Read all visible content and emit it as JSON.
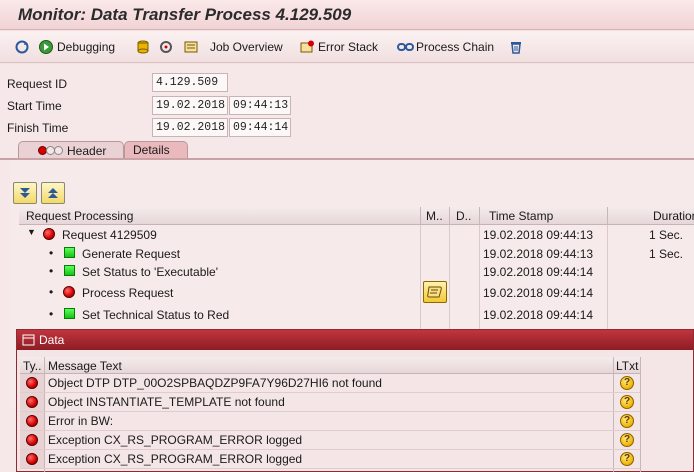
{
  "window": {
    "title": "Monitor: Data Transfer Process 4.129.509"
  },
  "toolbar": {
    "debugging_label": "Debugging",
    "job_overview_label": "Job Overview",
    "error_stack_label": "Error Stack",
    "process_chain_label": "Process Chain"
  },
  "fields": {
    "request_id_label": "Request ID",
    "request_id_value": "4.129.509",
    "start_time_label": "Start Time",
    "start_date": "19.02.2018",
    "start_time": "09:44:13",
    "finish_time_label": "Finish Time",
    "finish_date": "19.02.2018",
    "finish_time": "09:44:14"
  },
  "tabs": {
    "header_label": "Header",
    "details_label": "Details"
  },
  "tree": {
    "columns": [
      "Request Processing",
      "M..",
      "D..",
      "Time Stamp",
      "Duration"
    ],
    "rows": [
      {
        "label": "Request 4129509",
        "status": "red",
        "timestamp": "19.02.2018 09:44:13",
        "duration": "1 Sec."
      },
      {
        "label": "Generate Request",
        "status": "green",
        "timestamp": "19.02.2018 09:44:13",
        "duration": "1 Sec."
      },
      {
        "label": "Set Status to 'Executable'",
        "status": "green",
        "timestamp": "19.02.2018 09:44:14",
        "duration": ""
      },
      {
        "label": "Process Request",
        "status": "red",
        "timestamp": "19.02.2018 09:44:14",
        "duration": ""
      },
      {
        "label": "Set Technical Status to Red",
        "status": "green",
        "timestamp": "19.02.2018 09:44:14",
        "duration": ""
      }
    ]
  },
  "popup": {
    "title": "Data",
    "columns": [
      "Ty..",
      "Message Text",
      "LTxt"
    ],
    "messages": [
      {
        "type": "error",
        "text": "Object DTP DTP_00O2SPBAQDZP9FA7Y96D27HI6 not found"
      },
      {
        "type": "error",
        "text": "Object INSTANTIATE_TEMPLATE  not found"
      },
      {
        "type": "error",
        "text": "Error in BW:"
      },
      {
        "type": "error",
        "text": "Exception CX_RS_PROGRAM_ERROR logged"
      },
      {
        "type": "error",
        "text": "Exception CX_RS_PROGRAM_ERROR logged"
      }
    ]
  },
  "colors": {
    "title_bar": "#f0d3d5",
    "popup_title": "#a7262f",
    "tab_active": "#e9b9bd",
    "error_red": "#d40000",
    "success_green": "#14c414"
  }
}
